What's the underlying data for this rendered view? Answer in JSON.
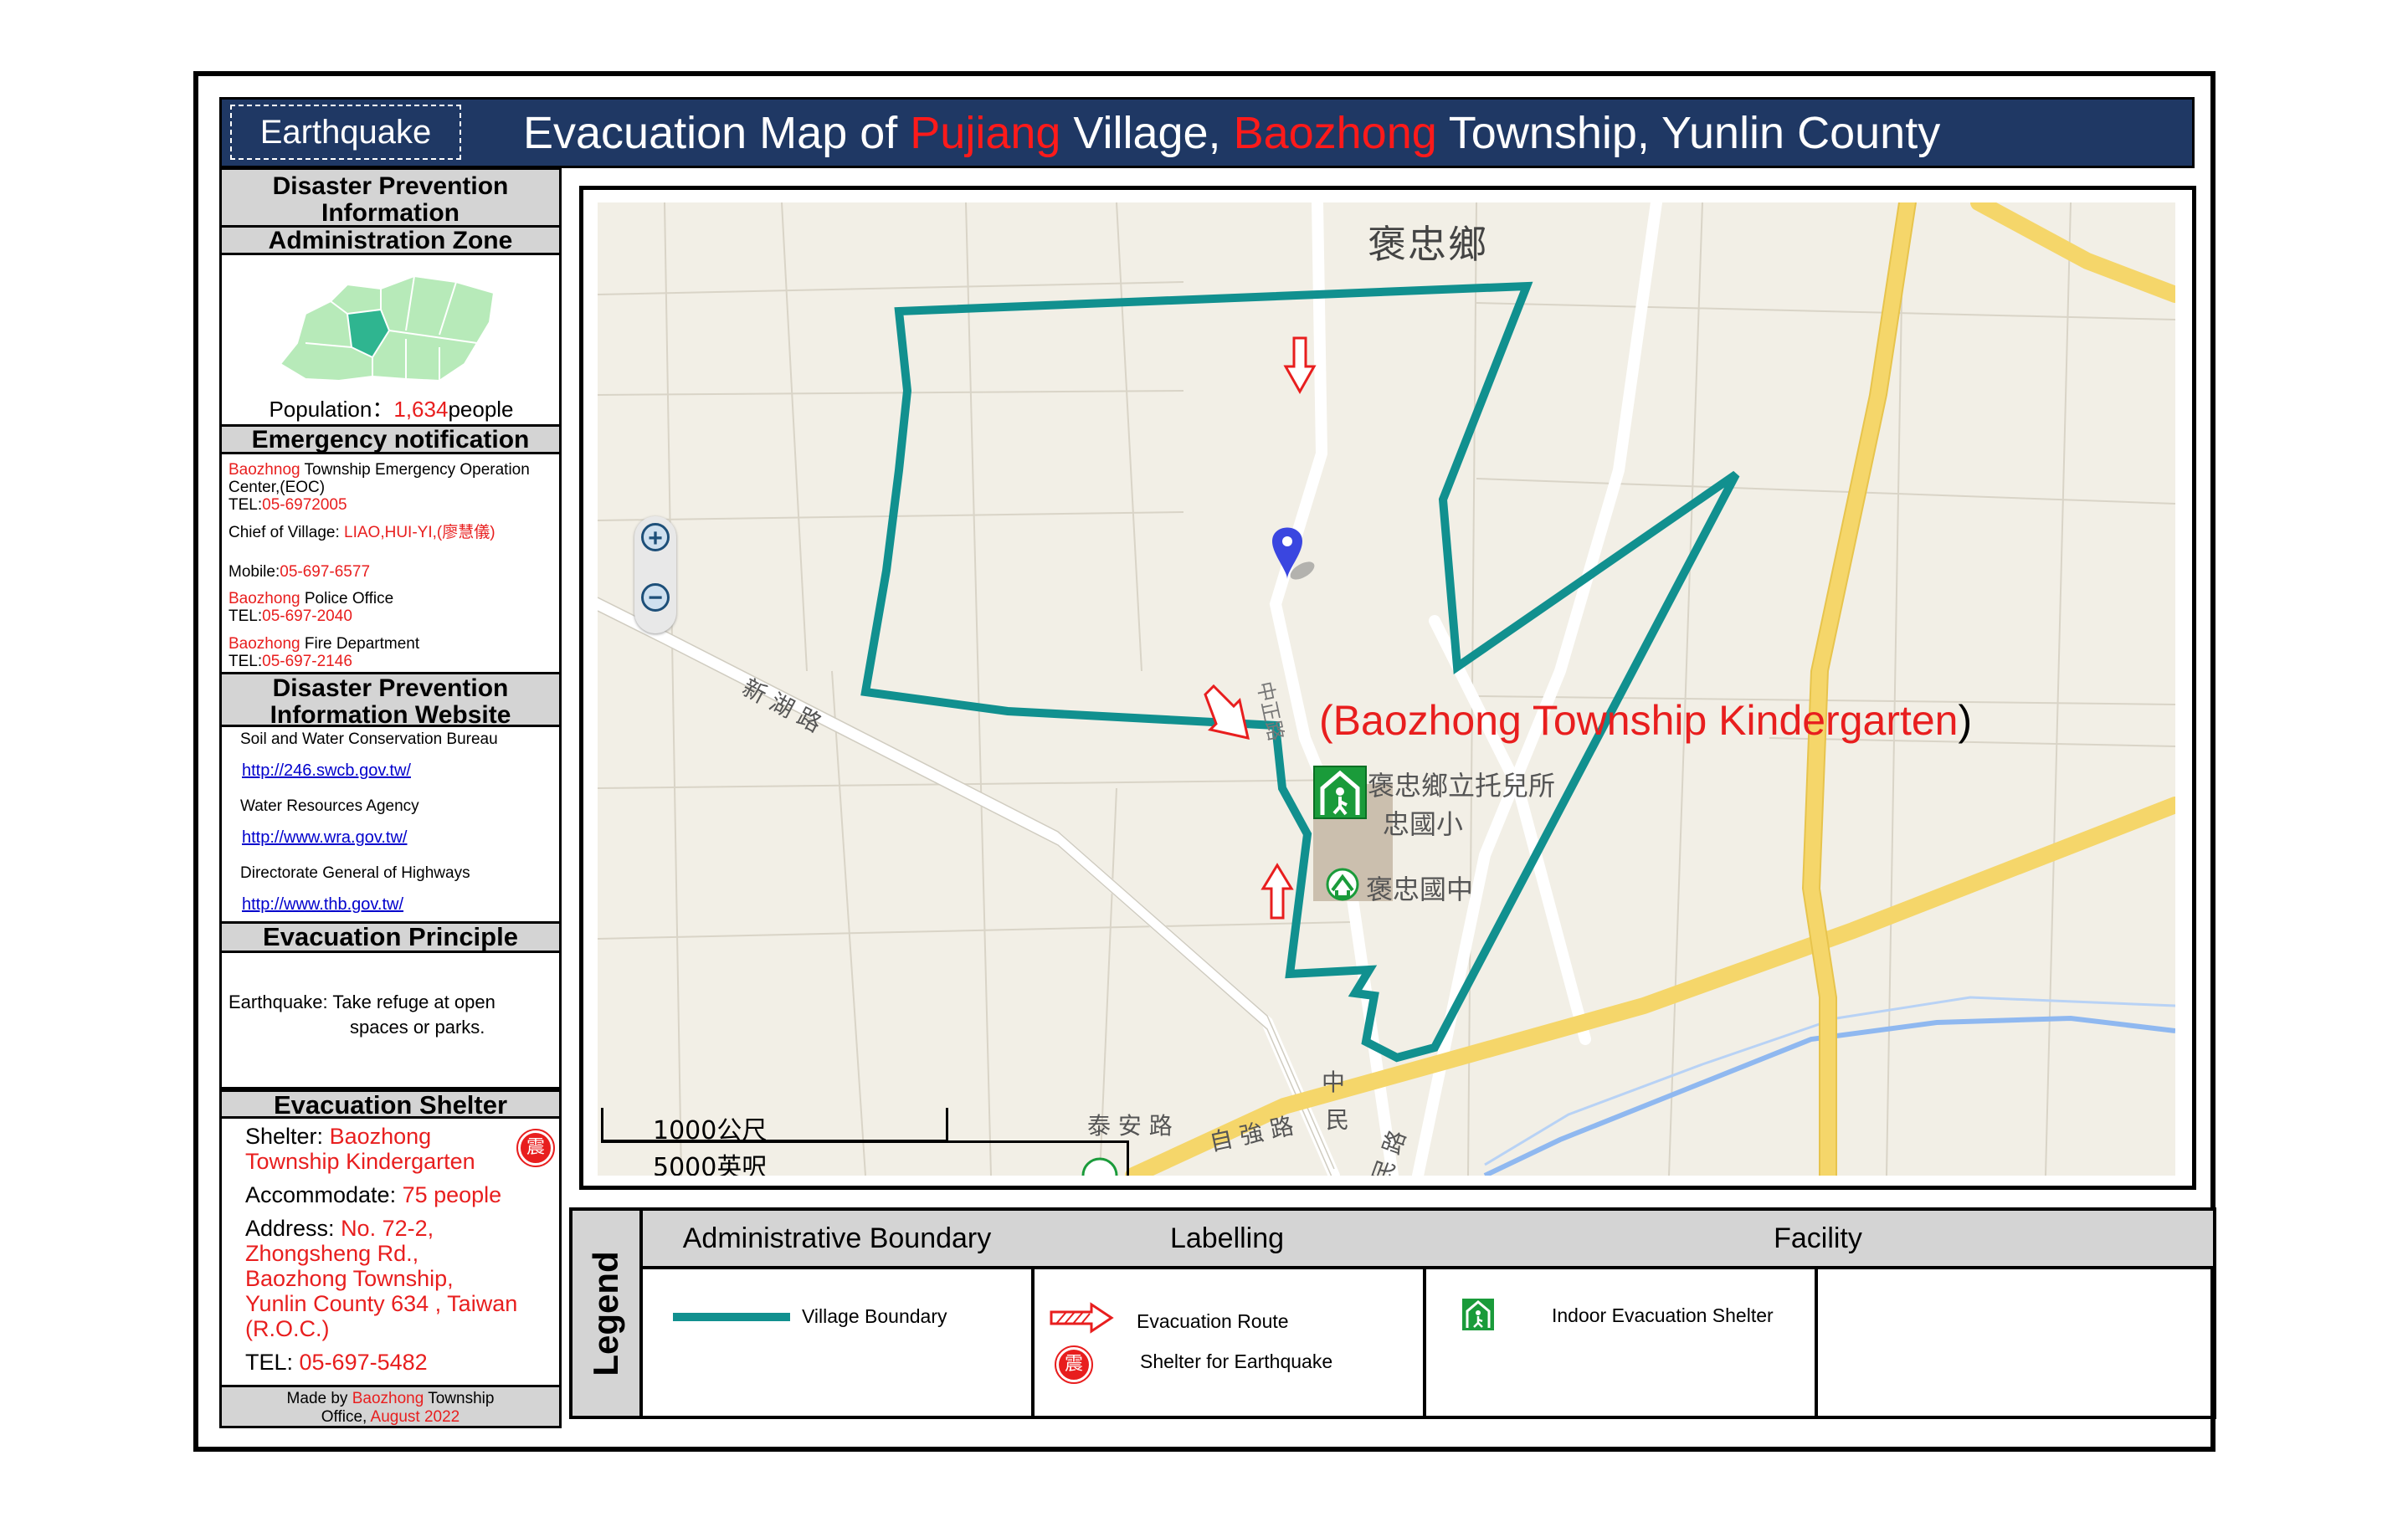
{
  "header": {
    "tag": "Earthquake",
    "title_parts": {
      "p1": "Evacuation Map of ",
      "village": "Pujiang",
      "p2": " Village, ",
      "township": "Baozhong",
      "p3": " Township, Yunlin County"
    }
  },
  "sidebar": {
    "dpi_title_1": "Disaster Prevention",
    "dpi_title_2": "Information",
    "admin_zone_title": "Administration Zone",
    "population_label": "Population：",
    "population_value": "1,634",
    "population_unit": "people",
    "emergency_title": "Emergency notification",
    "eoc_red": "Baozhnog",
    "eoc_rest": " Township Emergency Operation Center,(EOC)",
    "eoc_tel_label": "TEL:",
    "eoc_tel": "05-6972005",
    "chief_label": "Chief of Village: ",
    "chief_value": "LIAO,HUI-YI,(廖慧儀)",
    "mobile_label": "Mobile:",
    "mobile_value": "05-697-6577",
    "police_red": "Baozhong",
    "police_rest": " Police Office",
    "police_tel_label": "TEL:",
    "police_tel": "05-697-2040",
    "fire_red": "Baozhong",
    "fire_rest": " Fire Department",
    "fire_tel_label": "TEL:",
    "fire_tel": "05-697-2146",
    "website_title_1": "Disaster Prevention",
    "website_title_2": "Information Website",
    "sites": [
      {
        "name": "Soil and Water Conservation Bureau",
        "url": "http://246.swcb.gov.tw/"
      },
      {
        "name": "Water Resources Agency",
        "url": "http://www.wra.gov.tw/"
      },
      {
        "name": "Directorate General of Highways",
        "url": "http://www.thb.gov.tw/"
      }
    ],
    "principle_title": "Evacuation Principle",
    "principle_line1": "Earthquake: Take refuge at open",
    "principle_line2": "spaces or parks.",
    "shelter_title": "Evacuation Shelter",
    "shelter_label": "Shelter: ",
    "shelter_value_1": "Baozhong",
    "shelter_value_2": "Township Kindergarten",
    "shelter_icon_char": "震",
    "accommodate_label": "Accommodate: ",
    "accommodate_value": "75 people",
    "address_label": "Address: ",
    "address_lines": [
      "No. 72-2,",
      "Zhongsheng Rd.,",
      "Baozhong Township,",
      "Yunlin County 634 , Taiwan",
      "(R.O.C.)"
    ],
    "tel_label": "TEL: ",
    "tel_value": "05-697-5482",
    "made_by_1": "Made by ",
    "made_by_red": "Baozhong",
    "made_by_2": " Township",
    "made_by_3": "Office, ",
    "made_by_date": "August 2022"
  },
  "map": {
    "township_label": "褒忠鄉",
    "road_new_lake": "新 湖 路",
    "road_taian": "泰 安 路",
    "road_zidan": "自 強 路",
    "road_minzhu": "民 路",
    "road_zhong": "中",
    "road_min2": "民",
    "road_zhongzheng": "中正路",
    "kindergarten_cn": "褒忠鄉立托兒所",
    "elementary_cn": "忠國小",
    "junior_cn": "褒忠國中",
    "shelter_callout_open": "(",
    "shelter_callout": "Baozhong Township Kindergarten",
    "shelter_callout_close": ")",
    "scale_1": "1000公尺",
    "scale_2": "5000英呎",
    "zoom_in": "+",
    "zoom_out": "−",
    "colors": {
      "boundary": "#11908f",
      "route": "#e81e1e",
      "road_major": "#f5d66a",
      "water": "#8fb8f0"
    }
  },
  "legend": {
    "title": "Legend",
    "col1_head": "Administrative Boundary",
    "col2_head": "Labelling",
    "col3_head": "Facility",
    "village_boundary": "Village Boundary",
    "evacuation_route": "Evacuation Route",
    "shelter_eq": "Shelter for Earthquake",
    "indoor_shelter": "Indoor Evacuation Shelter"
  }
}
